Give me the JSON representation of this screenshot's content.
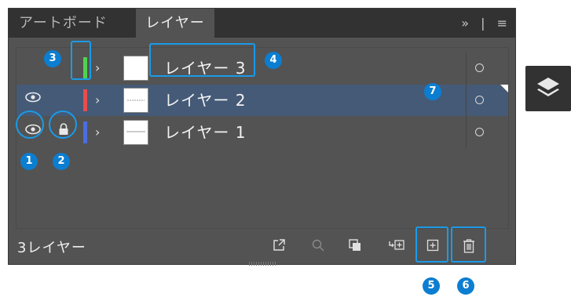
{
  "tabs": [
    {
      "label": "アートボード",
      "active": false
    },
    {
      "label": "レイヤー",
      "active": true
    }
  ],
  "tab_menu": {
    "overflow_glyph": "»",
    "divider": "|",
    "menu_glyph": "≡"
  },
  "layers": [
    {
      "name": "レイヤー 3",
      "color": "#4ed34e",
      "visible": false,
      "locked": false,
      "selected": false
    },
    {
      "name": "レイヤー 2",
      "color": "#e84c4c",
      "visible": true,
      "locked": false,
      "selected": true
    },
    {
      "name": "レイヤー 1",
      "color": "#4a6ee0",
      "visible": true,
      "locked": true,
      "selected": false
    }
  ],
  "footer": {
    "layer_count": "3レイヤー"
  },
  "buttons": [
    {
      "icon": "export-icon",
      "state": "enabled"
    },
    {
      "icon": "search-icon",
      "state": "disabled"
    },
    {
      "icon": "clipping-mask-icon",
      "state": "enabled"
    },
    {
      "icon": "new-sublayer-icon",
      "state": "enabled"
    },
    {
      "icon": "new-layer-icon",
      "state": "enabled"
    },
    {
      "icon": "trash-icon",
      "state": "enabled"
    }
  ],
  "annotations": {
    "n1": "1",
    "n2": "2",
    "n3": "3",
    "n4": "4",
    "n5": "5",
    "n6": "6",
    "n7": "7",
    "color": "#0b7ed1"
  },
  "colors": {
    "panel_bg": "#535353",
    "tab_bg": "#323232",
    "selected_row": "#445a77"
  }
}
